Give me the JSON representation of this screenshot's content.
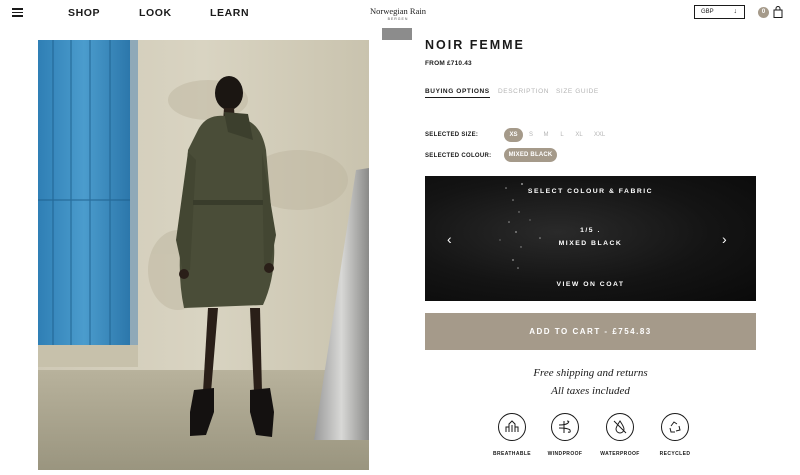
{
  "header": {
    "nav": [
      "SHOP",
      "LOOK",
      "LEARN"
    ],
    "brand_name": "Norwegian Rain",
    "brand_sub": "BERGEN",
    "currency": "GBP",
    "cart_count": "0"
  },
  "product": {
    "title": "NOIR FEMME",
    "price": "FROM £710.43"
  },
  "tabs": [
    "BUYING OPTIONS",
    "DESCRIPTION",
    "SIZE GUIDE"
  ],
  "options": {
    "size_label": "SELECTED SIZE:",
    "sizes": [
      "XS",
      "S",
      "M",
      "L",
      "XL",
      "XXL"
    ],
    "selected_size": "XS",
    "colour_label": "SELECTED COLOUR:",
    "selected_colour": "MIXED BLACK"
  },
  "fabric_panel": {
    "title": "SELECT COLOUR & FABRIC",
    "counter": "1/5 .",
    "colour_name": "MIXED BLACK",
    "view_link": "VIEW ON COAT"
  },
  "cart": {
    "button": "ADD TO CART - £754.83"
  },
  "shipping": {
    "line1": "Free shipping and returns",
    "line2": "All taxes included"
  },
  "features": [
    "BREATHABLE",
    "WINDPROOF",
    "WATERPROOF",
    "RECYCLED"
  ],
  "colors": {
    "accent": "#a59a8a",
    "text": "#1a1a1a",
    "muted": "#b4b4b4"
  }
}
